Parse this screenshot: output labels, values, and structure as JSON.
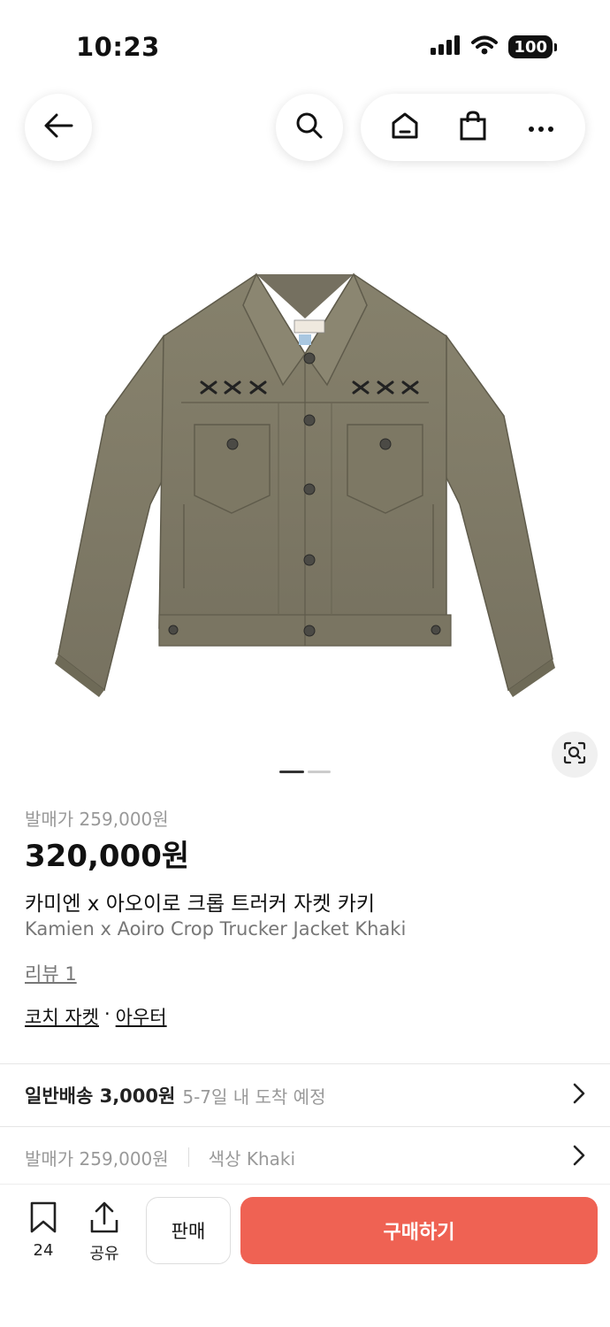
{
  "status": {
    "time": "10:23",
    "battery": "100"
  },
  "nav": {
    "back_icon": "back-arrow-icon",
    "search_icon": "search-icon",
    "home_icon": "home-icon",
    "bag_icon": "shopping-bag-icon",
    "more_icon": "more-icon"
  },
  "product": {
    "image_alt": "khaki crop trucker jacket",
    "release_price": "발매가 259,000원",
    "price": "320,000원",
    "name_kr": "카미엔 x 아오이로 크롭 트러커 자켓 카키",
    "name_en": "Kamien x Aoiro Crop Trucker Jacket Khaki",
    "reviews": "리뷰 1",
    "category_1": "코치 자켓",
    "category_sep": "·",
    "category_2": "아우터"
  },
  "shipping": {
    "title": "일반배송 3,000원",
    "sub": "5-7일 내 도착 예정"
  },
  "summary_row": {
    "release_price": "발매가 259,000원",
    "color": "색상 Khaki"
  },
  "bottom": {
    "wish_count": "24",
    "share_label": "공유",
    "sell_label": "판매",
    "buy_label": "구매하기"
  },
  "colors": {
    "accent": "#ef6253",
    "jacket": "#7f7a66"
  }
}
